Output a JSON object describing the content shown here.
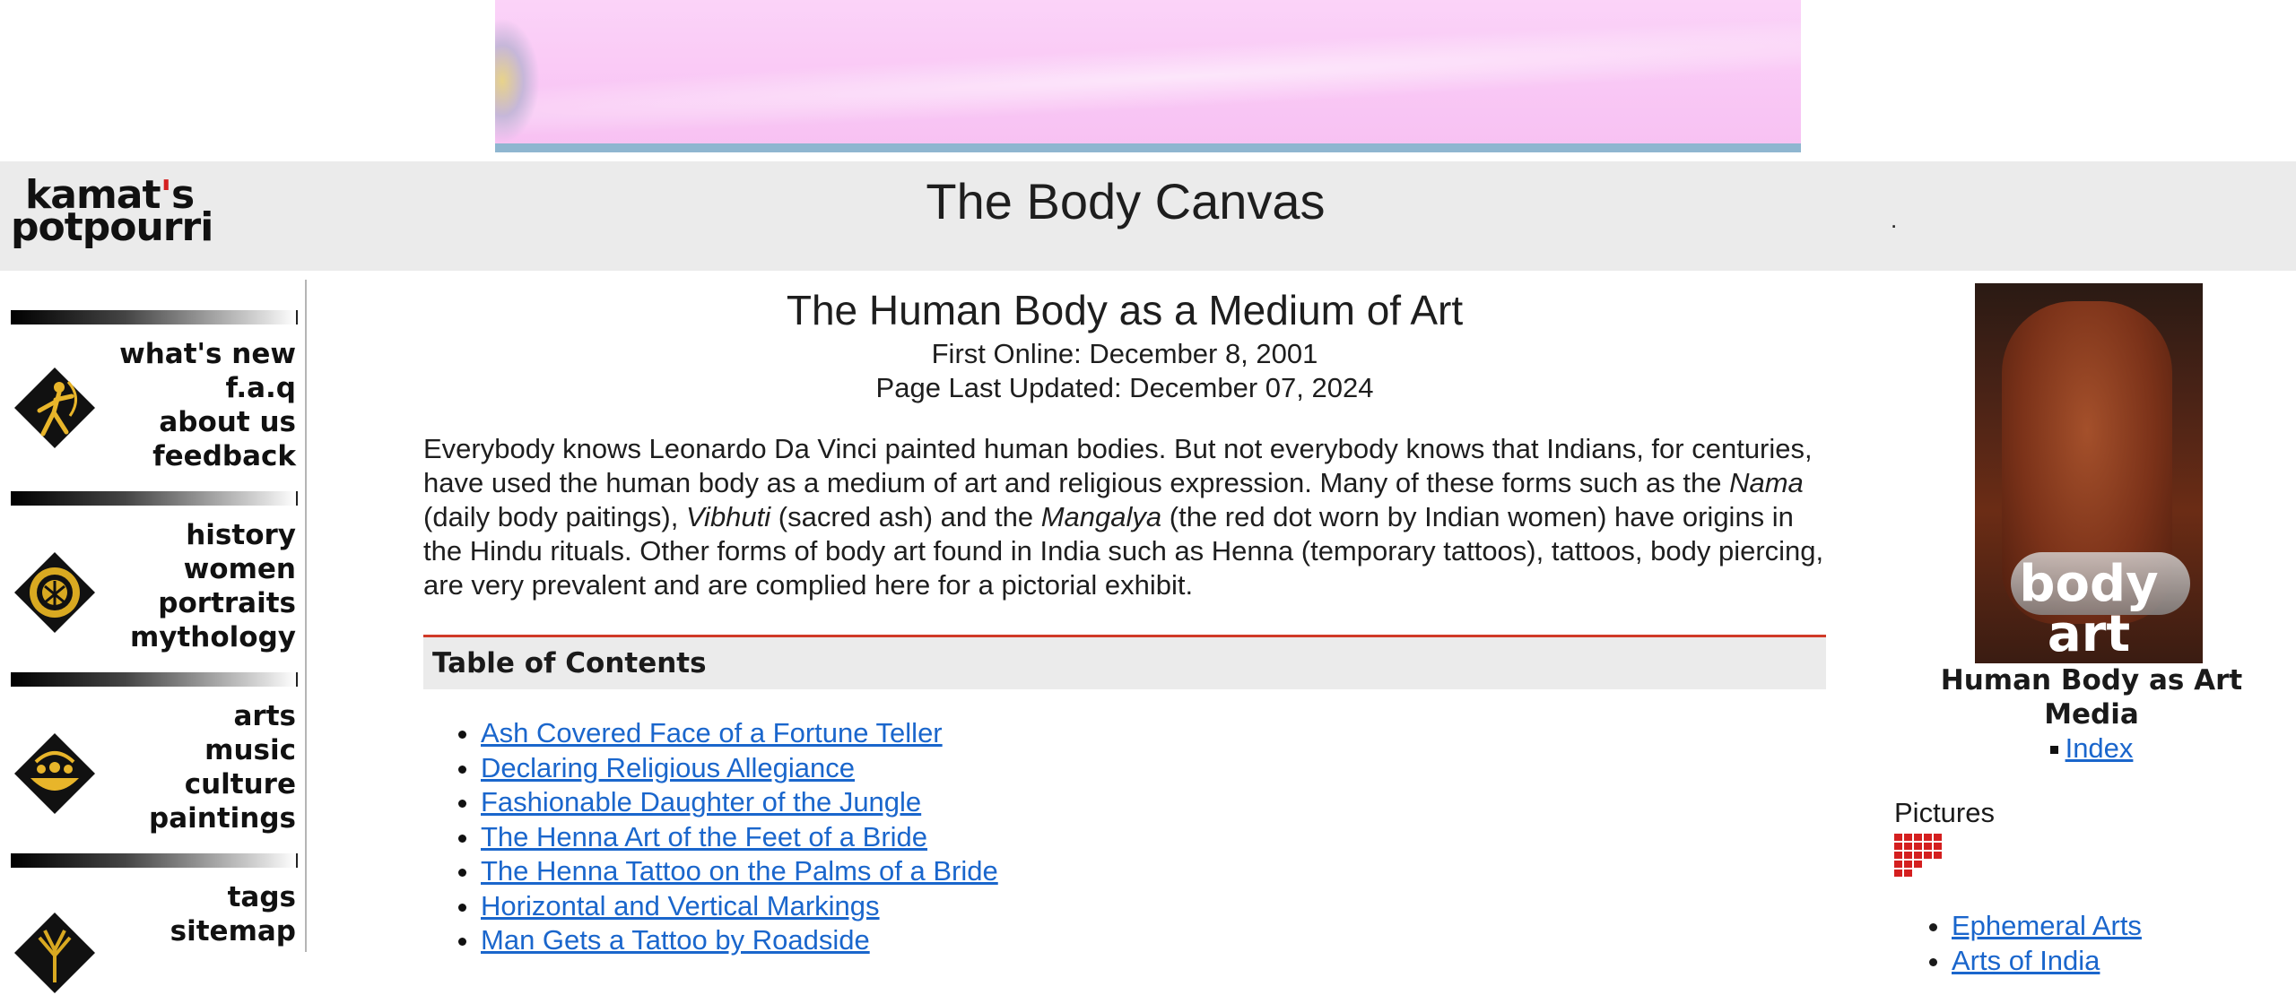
{
  "header": {
    "logo_line1": "kamat",
    "logo_apos": "'",
    "logo_line1_end": "s",
    "logo_line2": "potpourri",
    "site_title": "The Body Canvas",
    "dot": "."
  },
  "nav": {
    "groups": [
      {
        "icon": "archer-icon",
        "links": [
          "what's new",
          "f.a.q",
          "about us",
          "feedback"
        ]
      },
      {
        "icon": "peacock-icon",
        "links": [
          "history",
          "women",
          "portraits",
          "mythology"
        ]
      },
      {
        "icon": "lamp-icon",
        "links": [
          "arts",
          "music",
          "culture",
          "paintings"
        ]
      },
      {
        "icon": "tree-icon",
        "links": [
          "tags",
          "sitemap"
        ]
      }
    ]
  },
  "main": {
    "heading": "The Human Body as a Medium of Art",
    "first_online": "First Online: December 8, 2001",
    "last_updated": "Page Last Updated: December 07, 2024",
    "intro": {
      "p1": "Everybody knows Leonardo Da Vinci painted human bodies. But not everybody knows that  Indians, for centuries, have used the human body as a medium of art and religious expression. Many of these forms such as the ",
      "nama": "Nama",
      "p2": " (daily body paitings), ",
      "vibhuti": "Vibhuti",
      "p3": " (sacred ash) and the ",
      "mangalya": "Mangalya",
      "p4": " (the red dot worn by Indian women) have origins in the Hindu rituals. Other forms of body art found in India such as Henna (temporary tattoos), tattoos, body piercing, are very prevalent and are complied here for a pictorial exhibit."
    },
    "toc_title": "Table of Contents",
    "toc": [
      "Ash Covered Face of a Fortune Teller",
      "Declaring Religious Allegiance",
      "Fashionable Daughter of the Jungle",
      "The Henna Art of the Feet of a Bride",
      "The Henna Tattoo on the Palms of a Bride",
      "Horizontal and Vertical Markings",
      "Man Gets a Tattoo by Roadside"
    ]
  },
  "right": {
    "image_caption": "body art",
    "title": "Human Body as Art Media",
    "index_link": "Index",
    "pictures_label": "Pictures",
    "links": [
      "Ephemeral Arts",
      "Arts of India"
    ]
  },
  "colors": {
    "link": "#1a66cc",
    "toc_rule": "#d03a28",
    "header_bg": "#ebebeb",
    "banner_pink": "#f9c7f5",
    "grid_red": "#d41f1f"
  }
}
